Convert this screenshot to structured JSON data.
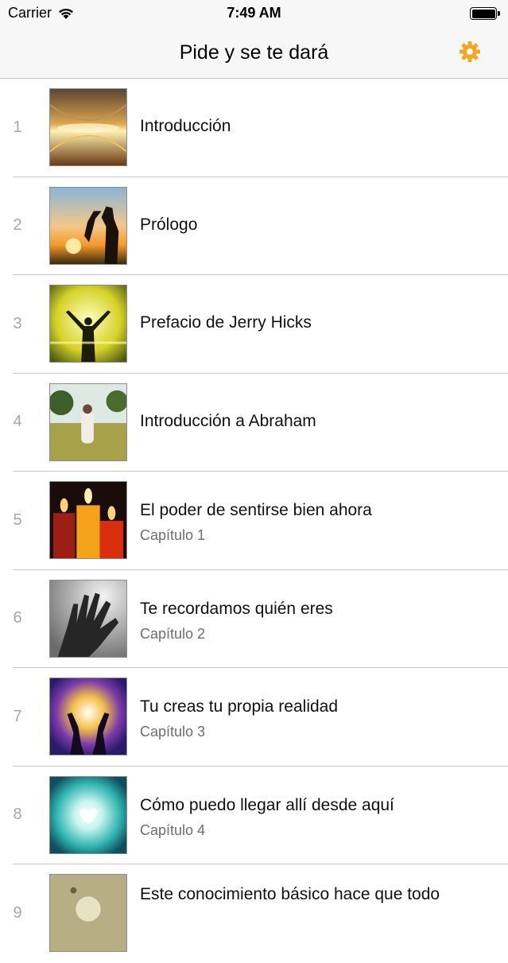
{
  "status_bar": {
    "carrier": "Carrier",
    "time": "7:49 AM"
  },
  "nav": {
    "title": "Pide y se te dará",
    "settings_icon": "gear-icon",
    "accent_color": "#f5a623"
  },
  "chapters": [
    {
      "number": "1",
      "title": "Introducción",
      "subtitle": ""
    },
    {
      "number": "2",
      "title": "Prólogo",
      "subtitle": ""
    },
    {
      "number": "3",
      "title": "Prefacio de Jerry Hicks",
      "subtitle": ""
    },
    {
      "number": "4",
      "title": "Introducción a Abraham",
      "subtitle": ""
    },
    {
      "number": "5",
      "title": "El poder de sentirse bien ahora",
      "subtitle": "Capítulo 1"
    },
    {
      "number": "6",
      "title": "Te recordamos quién eres",
      "subtitle": "Capítulo 2"
    },
    {
      "number": "7",
      "title": "Tu creas tu propia realidad",
      "subtitle": "Capítulo 3"
    },
    {
      "number": "8",
      "title": "Cómo puedo llegar allí desde aquí",
      "subtitle": "Capítulo 4"
    },
    {
      "number": "9",
      "title": "Este conocimiento básico hace que todo",
      "subtitle": ""
    }
  ]
}
